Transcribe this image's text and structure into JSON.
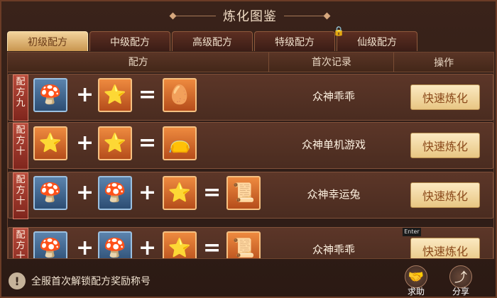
{
  "title": "炼化图鉴",
  "tabs": [
    {
      "label": "初级配方",
      "active": true
    },
    {
      "label": "中级配方",
      "active": false
    },
    {
      "label": "高级配方",
      "active": false
    },
    {
      "label": "特级配方",
      "active": false
    },
    {
      "label": "仙级配方",
      "active": false,
      "locked": true
    }
  ],
  "table": {
    "headers": {
      "recipe": "配方",
      "first_record": "首次记录",
      "action": "操作"
    },
    "rows": [
      {
        "label": "配方九",
        "ingredients": [
          "blue-mushroom-icon",
          "orange-star-herb-icon"
        ],
        "result": "golden-egg-icon",
        "player": "众神乖乖",
        "button": "快速炼化"
      },
      {
        "label": "配方十",
        "ingredients": [
          "orange-star-herb-icon",
          "orange-star-herb-icon"
        ],
        "result": "purple-pouch-icon",
        "player": "众神单机游戏",
        "button": "快速炼化"
      },
      {
        "label": "配方十一",
        "ingredients": [
          "brown-mushroom-icon",
          "brown-mushroom-icon",
          "orange-star-herb-icon"
        ],
        "result": "golden-scroll-icon",
        "player": "众神幸运兔",
        "button": "快速炼化"
      },
      {
        "label": "配方十",
        "ingredients": [
          "blue-mushroom-icon",
          "blue-mushroom-icon",
          "orange-star-herb-icon"
        ],
        "result": "golden-scroll-icon",
        "player": "众神乖乖",
        "button": "快速炼化"
      }
    ]
  },
  "bottom": {
    "tip": "全服首次解锁配方奖励称号",
    "help_label": "求助",
    "share_label": "分享"
  },
  "tooltip": "Enter"
}
